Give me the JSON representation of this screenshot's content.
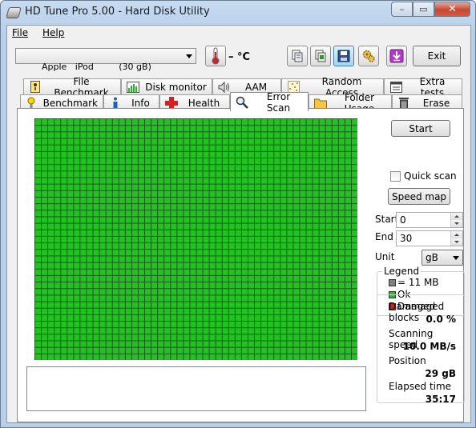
{
  "window": {
    "title": "HD Tune Pro 5.00 - Hard Disk Utility",
    "min_label": "–",
    "max_label": "▭",
    "close_label": "✕"
  },
  "menu": {
    "file": "File",
    "help": "Help"
  },
  "toolbar": {
    "drive": "Apple   iPod         (30 gB)",
    "temperature": "– °C",
    "exit_label": "Exit"
  },
  "tabs_row1": [
    {
      "label": "File Benchmark",
      "icon": "file-benchmark-icon"
    },
    {
      "label": "Disk monitor",
      "icon": "disk-monitor-icon"
    },
    {
      "label": "AAM",
      "icon": "speaker-icon"
    },
    {
      "label": "Random Access",
      "icon": "random-access-icon"
    },
    {
      "label": "Extra tests",
      "icon": "extra-tests-icon"
    }
  ],
  "tabs_row2": [
    {
      "label": "Benchmark",
      "icon": "benchmark-icon"
    },
    {
      "label": "Info",
      "icon": "info-icon"
    },
    {
      "label": "Health",
      "icon": "health-icon"
    },
    {
      "label": "Error Scan",
      "icon": "magnifier-icon",
      "active": true
    },
    {
      "label": "Folder Usage",
      "icon": "folder-icon"
    },
    {
      "label": "Erase",
      "icon": "trash-icon"
    }
  ],
  "scan": {
    "start_button": "Start",
    "quick_scan_label": "Quick scan",
    "quick_scan_checked": false,
    "speed_map_button": "Speed map",
    "start_label": "Start",
    "start_value": "0",
    "end_label": "End",
    "end_value": "30",
    "unit_label": "Unit",
    "unit_value": "gB",
    "grid": {
      "columns": 50,
      "rows": 37,
      "status": "ok"
    }
  },
  "legend": {
    "title": "Legend",
    "items": [
      {
        "label": "= 11 MB",
        "color": "#808080"
      },
      {
        "label": "Ok",
        "color": "#22c222"
      },
      {
        "label": "Damaged",
        "color": "#d42020"
      }
    ]
  },
  "stats": {
    "damaged_label": "Damaged blocks",
    "damaged_value": "0.0 %",
    "speed_label": "Scanning speed",
    "speed_value": "10.0 MB/s",
    "position_label": "Position",
    "position_value": "29 gB",
    "elapsed_label": "Elapsed time",
    "elapsed_value": "35:17"
  },
  "colors": {
    "ok_block": "#22c222",
    "grid_line": "#1e5a1e",
    "accent": "#3c7fb1"
  }
}
